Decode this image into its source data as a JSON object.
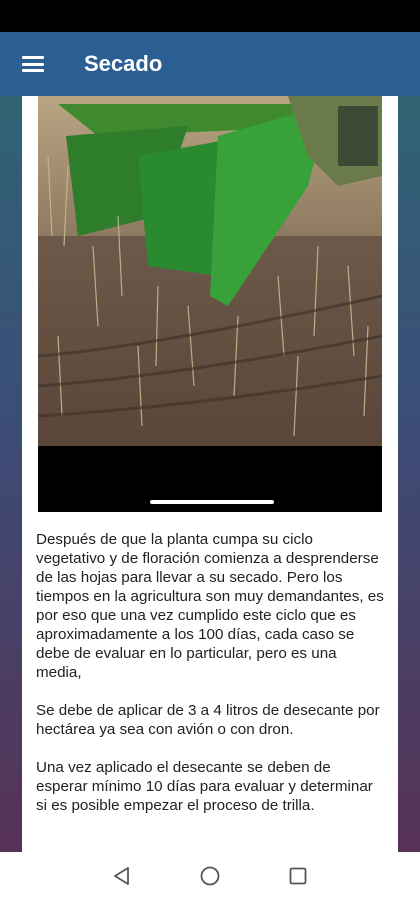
{
  "app_bar": {
    "title": "Secado",
    "menu_icon": "hamburger-menu-icon"
  },
  "media": {
    "image_subject": "green combine harvester header cutting dry crop stubble",
    "video_progress": null
  },
  "body": {
    "paragraphs": [
      "Después de que la planta cumpa su ciclo vegetativo y de floración comienza a desprenderse de las hojas para llevar a su secado. Pero los tiempos en la agricultura son muy demandantes, es por eso que una vez cumplido este ciclo que es aproximadamente a los 100 días, cada caso se debe de evaluar en lo particular, pero es una media,",
      "Se debe de aplicar de 3 a 4 litros de desecante por hectárea ya sea con avión o con dron.",
      "Una vez aplicado el desecante se deben de esperar mínimo 10 días para evaluar y determinar si es posible empezar el proceso de trilla."
    ]
  },
  "nav_bar": {
    "icons": [
      "back-triangle-icon",
      "home-circle-icon",
      "recents-square-icon"
    ]
  },
  "colors": {
    "app_bar": "#2b5f94",
    "status_bar": "#000000",
    "text": "#222222",
    "combine_green": "#2f8f2a"
  }
}
